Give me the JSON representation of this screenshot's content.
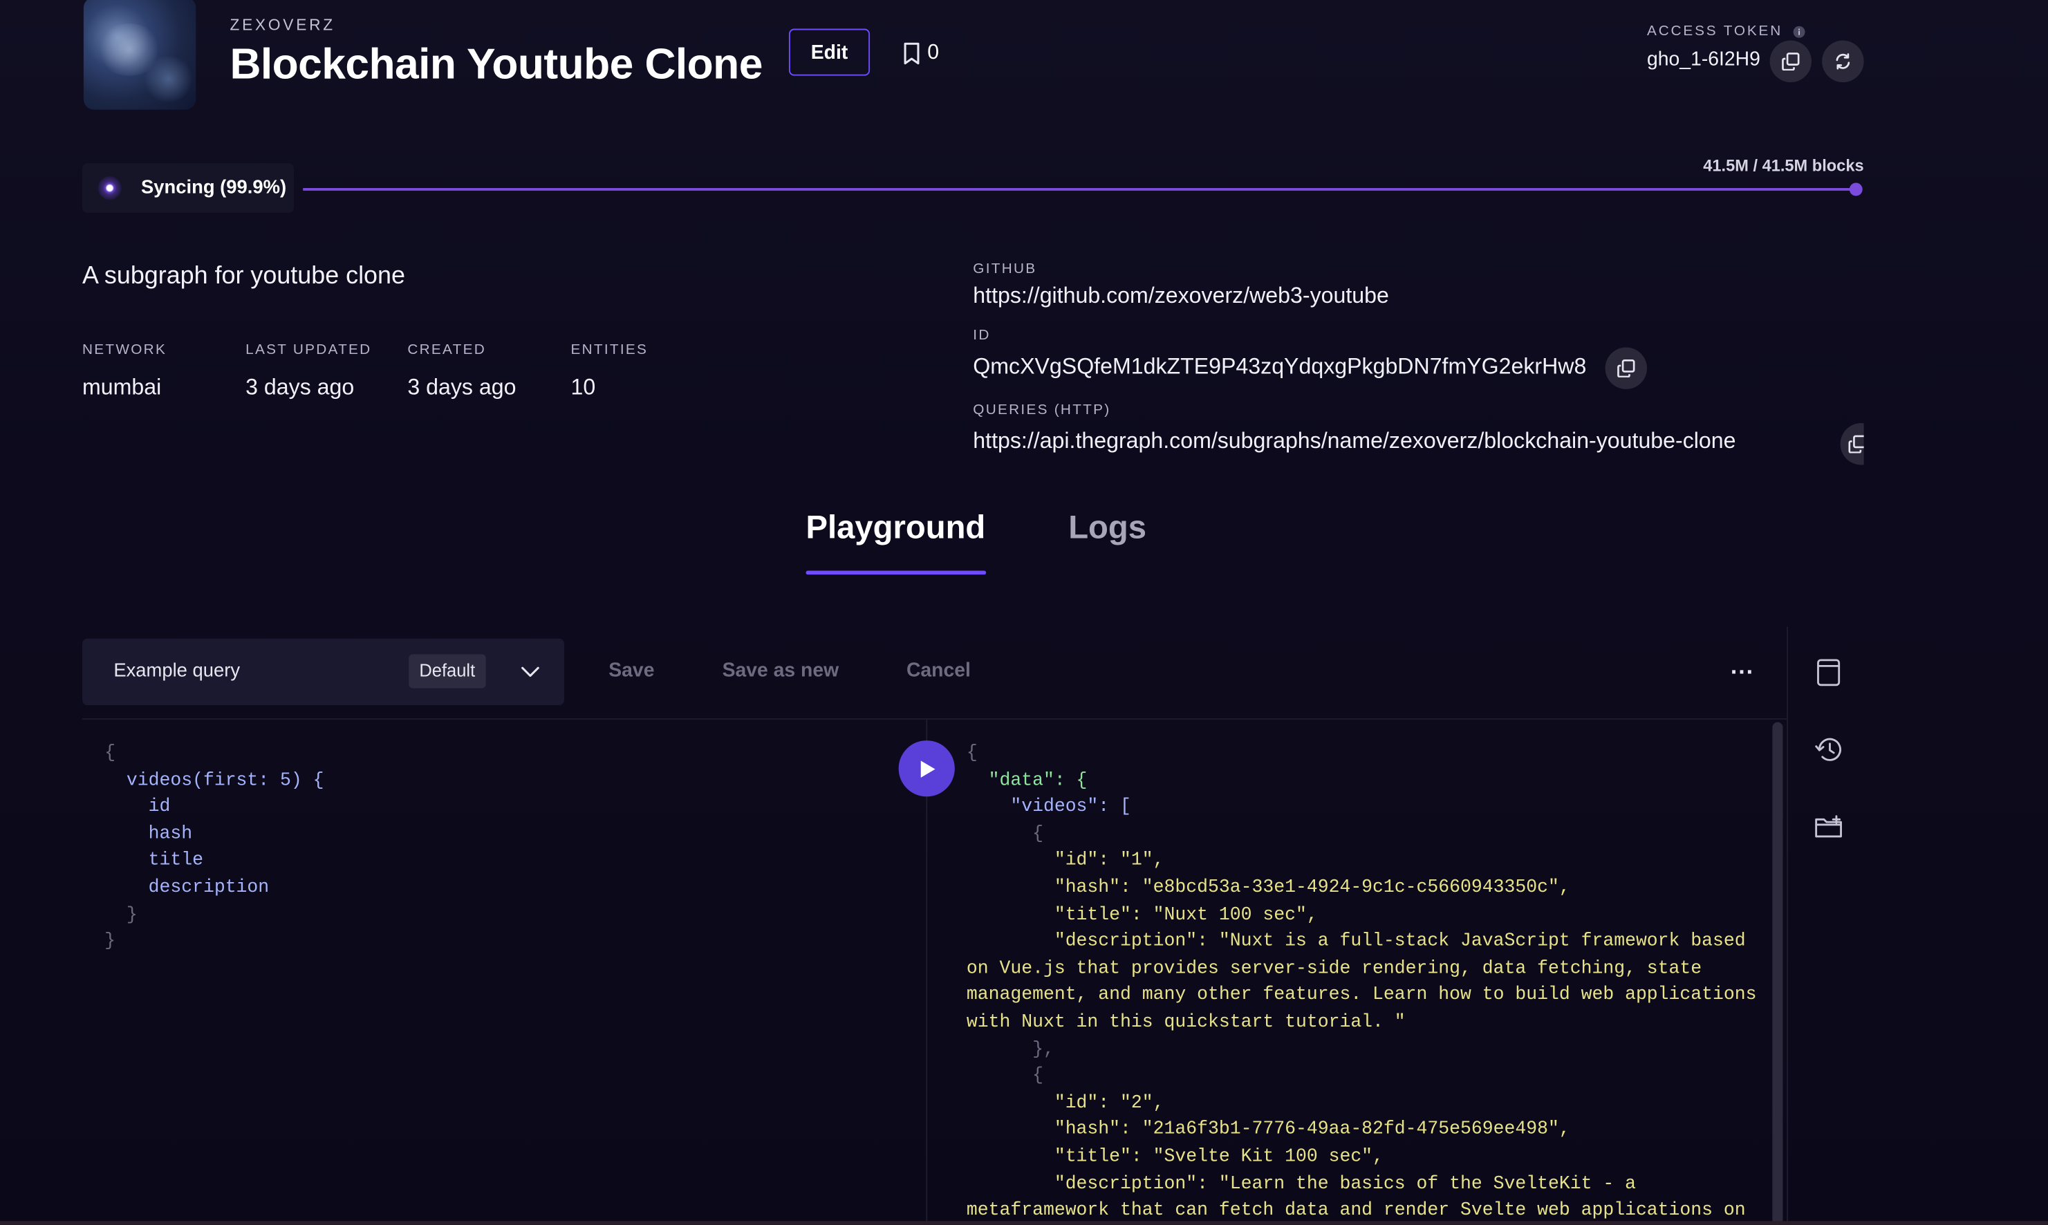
{
  "header": {
    "owner": "ZEXOVERZ",
    "title": "Blockchain Youtube Clone",
    "edit_label": "Edit",
    "bookmark_count": "0",
    "access_token_label": "ACCESS TOKEN",
    "access_token_value": "gho_1-6I2H9"
  },
  "sync": {
    "status_label": "Syncing (99.9%)",
    "progress_percent": 99.9,
    "blocks_label": "41.5M / 41.5M blocks"
  },
  "info": {
    "description": "A subgraph for youtube clone",
    "stats": [
      {
        "label": "NETWORK",
        "value": "mumbai"
      },
      {
        "label": "LAST UPDATED",
        "value": "3 days ago"
      },
      {
        "label": "CREATED",
        "value": "3 days ago"
      },
      {
        "label": "ENTITIES",
        "value": "10"
      }
    ],
    "github_label": "GITHUB",
    "github_value": "https://github.com/zexoverz/web3-youtube",
    "id_label": "ID",
    "id_value": "QmcXVgSQfeM1dkZTE9P43zqYdqxgPkgbDN7fmYG2ekrHw8",
    "queries_label": "QUERIES (HTTP)",
    "queries_value": "https://api.thegraph.com/subgraphs/name/zexoverz/blockchain-youtube-clone"
  },
  "tabs": [
    {
      "label": "Playground",
      "active": true
    },
    {
      "label": "Logs",
      "active": false
    }
  ],
  "playground": {
    "query_name": "Example query",
    "query_badge": "Default",
    "save_label": "Save",
    "save_as_new_label": "Save as new",
    "cancel_label": "Cancel",
    "more_label": "...",
    "query_lines": [
      "{",
      "  videos(first: 5) {",
      "    id",
      "    hash",
      "    title",
      "    description",
      "  }",
      "}"
    ],
    "result_lines": [
      "{",
      "  \"data\": {",
      "    \"videos\": [",
      "      {",
      "        \"id\": \"1\",",
      "        \"hash\": \"e8bcd53a-33e1-4924-9c1c-c5660943350c\",",
      "        \"title\": \"Nuxt 100 sec\",",
      "        \"description\": \"Nuxt is a full-stack JavaScript framework based",
      "on Vue.js that provides server-side rendering, data fetching, state",
      "management, and many other features. Learn how to build web applications",
      "with Nuxt in this quickstart tutorial. \"",
      "      },",
      "      {",
      "        \"id\": \"2\",",
      "        \"hash\": \"21a6f3b1-7776-49aa-82fd-475e569ee498\",",
      "        \"title\": \"Svelte Kit 100 sec\",",
      "        \"description\": \"Learn the basics of the SvelteKit - a",
      "metaframework that can fetch data and render Svelte web applications on"
    ]
  },
  "colors": {
    "accent": "#6f4cff",
    "progress": "#7b4bdc",
    "background": "#0c0a1c"
  },
  "icons": [
    "avatar-image",
    "bookmark-icon",
    "copy-icon",
    "refresh-icon",
    "info-icon",
    "chevron-down-icon",
    "play-icon",
    "document-icon",
    "history-icon",
    "folder-add-icon"
  ]
}
